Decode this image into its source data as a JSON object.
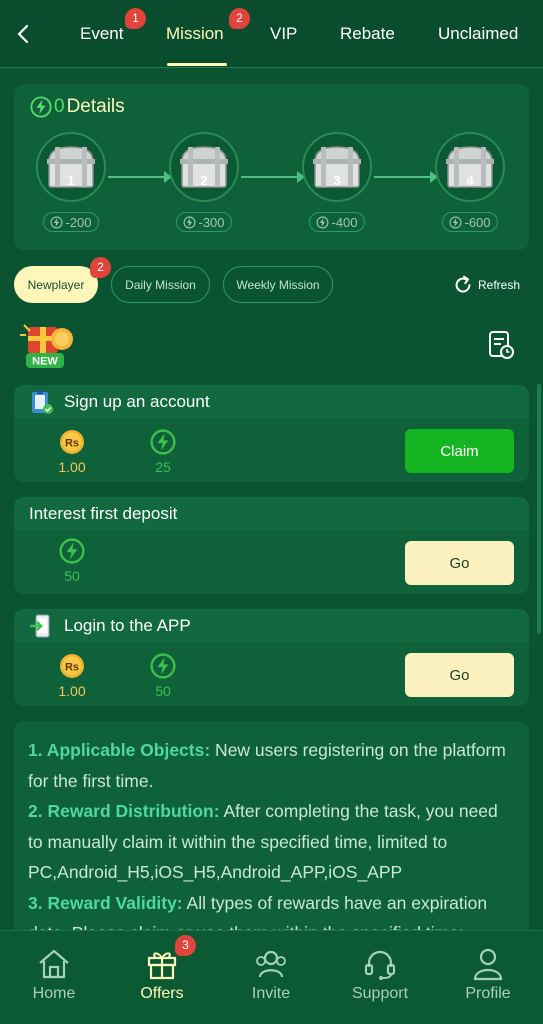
{
  "tabs": [
    {
      "label": "Event",
      "badge": "1"
    },
    {
      "label": "Mission",
      "badge": "2",
      "active": true
    },
    {
      "label": "VIP"
    },
    {
      "label": "Rebate"
    },
    {
      "label": "Unclaimed"
    }
  ],
  "details": {
    "count": "0",
    "title": "Details",
    "chests": [
      {
        "num": "1",
        "cost": "-200"
      },
      {
        "num": "2",
        "cost": "-300"
      },
      {
        "num": "3",
        "cost": "-400"
      },
      {
        "num": "4",
        "cost": "-600"
      }
    ]
  },
  "filters": {
    "newplayer": "Newplayer",
    "newplayer_badge": "2",
    "daily": "Daily Mission",
    "weekly": "Weekly Mission",
    "refresh": "Refresh"
  },
  "new_badge_text": "NEW",
  "missions": [
    {
      "title": "Sign up an account",
      "rs": "1.00",
      "bolt": "25",
      "button": "Claim"
    },
    {
      "title": "Interest first deposit",
      "bolt": "50",
      "button": "Go"
    },
    {
      "title": "Login to the APP",
      "rs": "1.00",
      "bolt": "50",
      "button": "Go"
    }
  ],
  "rules": [
    {
      "head": "1. Applicable Objects:",
      "text": " New users registering on the platform for the first time."
    },
    {
      "head": "2. Reward Distribution:",
      "text": " After completing the task, you need to manually claim it within the specified time, limited to PC,Android_H5,iOS_H5,Android_APP,iOS_APP"
    },
    {
      "head": "3. Reward Validity:",
      "text": " All types of rewards have an expiration date. Please claim or use them within the specified time;"
    }
  ],
  "nav": {
    "home": "Home",
    "offers": "Offers",
    "offers_badge": "3",
    "invite": "Invite",
    "support": "Support",
    "profile": "Profile"
  },
  "colors": {
    "background": "#0b5432",
    "accent_yellow": "#fff6b9",
    "claim_green": "#14b521",
    "badge_red": "#e0443b"
  }
}
